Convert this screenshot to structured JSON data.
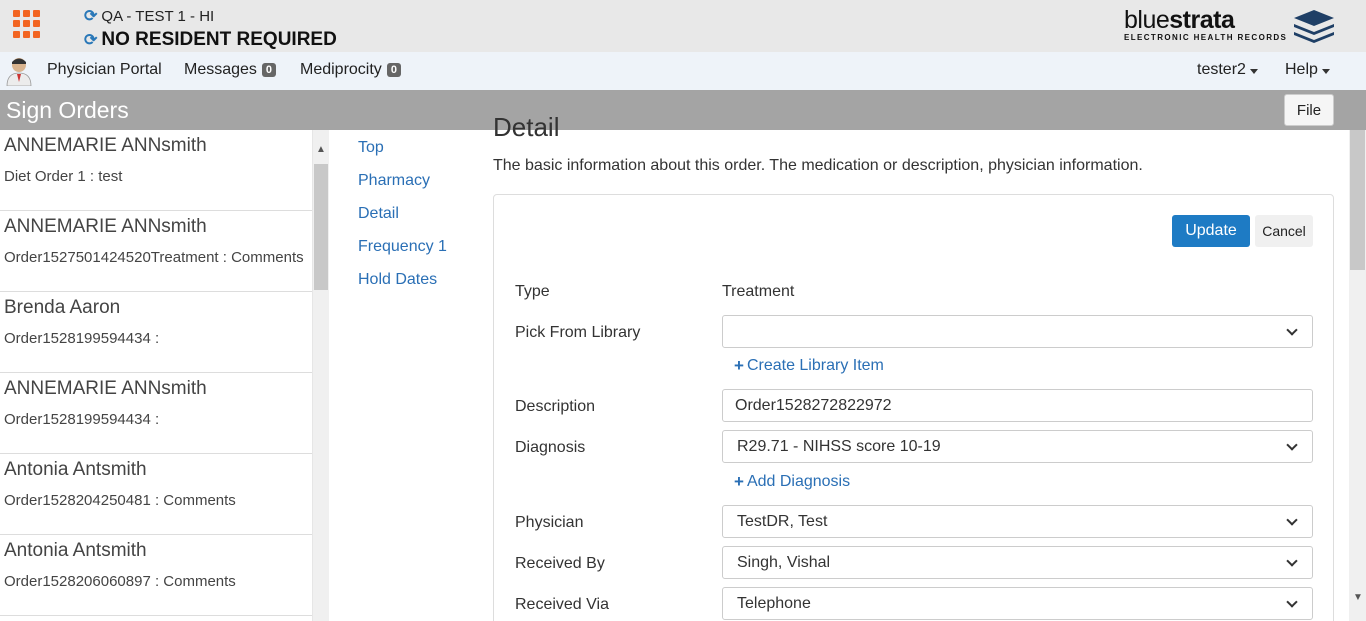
{
  "header": {
    "facility": "QA - TEST 1 - HI",
    "resident": "NO RESIDENT REQUIRED",
    "logo": {
      "word_light": "blue",
      "word_bold": "strata",
      "tagline": "ELECTRONIC HEALTH RECORDS"
    }
  },
  "nav": {
    "physician_portal": "Physician Portal",
    "messages": "Messages",
    "messages_count": "0",
    "mediprocity": "Mediprocity",
    "mediprocity_count": "0",
    "user": "tester2",
    "help": "Help"
  },
  "titlebar": {
    "title": "Sign Orders",
    "file": "File"
  },
  "orders": [
    {
      "name": "ANNEMARIE ANNsmith",
      "order": "Diet Order 1 : test"
    },
    {
      "name": "ANNEMARIE ANNsmith",
      "order": "Order1527501424520Treatment : Comments"
    },
    {
      "name": "Brenda Aaron",
      "order": "Order1528199594434 :"
    },
    {
      "name": "ANNEMARIE ANNsmith",
      "order": "Order1528199594434 :"
    },
    {
      "name": "Antonia Antsmith",
      "order": "Order1528204250481 : Comments"
    },
    {
      "name": "Antonia Antsmith",
      "order": "Order1528206060897 : Comments"
    }
  ],
  "sections": [
    "Top",
    "Pharmacy",
    "Detail",
    "Frequency 1",
    "Hold Dates"
  ],
  "detail": {
    "heading": "Detail",
    "description": "The basic information about this order. The medication or description, physician information.",
    "update": "Update",
    "cancel": "Cancel",
    "type_label": "Type",
    "type_value": "Treatment",
    "library_label": "Pick From Library",
    "library_value": "",
    "create_library": "Create Library Item",
    "description_label": "Description",
    "description_value": "Order1528272822972",
    "diagnosis_label": "Diagnosis",
    "diagnosis_value": "R29.71 - NIHSS score 10-19",
    "add_diagnosis": "Add Diagnosis",
    "physician_label": "Physician",
    "physician_value": "TestDR, Test",
    "received_by_label": "Received By",
    "received_by_value": "Singh, Vishal",
    "received_via_label": "Received Via",
    "received_via_value": "Telephone"
  },
  "colors": {
    "accent": "#1e7bc4",
    "apps": "#f26522",
    "titlebar": "#a4a4a4"
  }
}
